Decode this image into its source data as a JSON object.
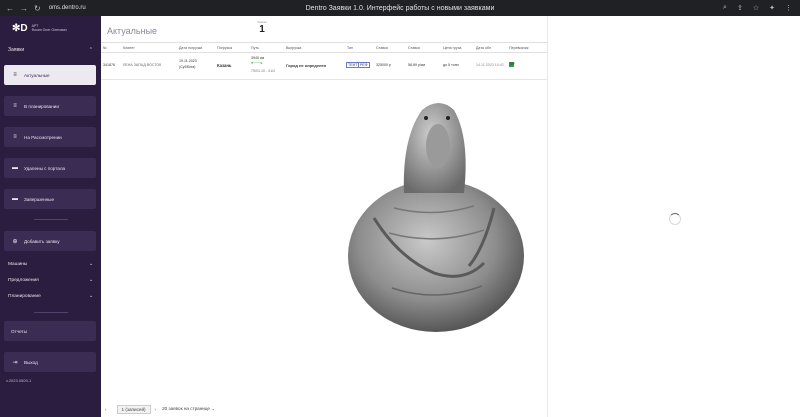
{
  "browser": {
    "url": "oms.dentro.ru",
    "window_title": "Dentro Заявки 1.0. Интерфейс работы с новыми заявками"
  },
  "sidebar": {
    "logo": "D",
    "user_role": "АРТ",
    "user_name": "Фокин Олег Олегович",
    "section_label": "Заявки",
    "items": [
      {
        "label": "Актуальные",
        "icon": "list-icon",
        "active": true
      },
      {
        "label": "В планировании",
        "icon": "list-icon"
      },
      {
        "label": "На Рассмотрении",
        "icon": "list-icon"
      },
      {
        "label": "Удалены с портала",
        "icon": "folder-icon"
      },
      {
        "label": "Завершенные",
        "icon": "folder-icon"
      }
    ],
    "add_label": "Добавить заявку",
    "folds": [
      "Машины",
      "Предложения",
      "Планирование"
    ],
    "reports_label": "Отчеты",
    "logout_label": "Выход",
    "version": "v.2023.0509-1"
  },
  "main": {
    "title": "Актуальные",
    "counter_label": "Заявки",
    "counter_value": "1",
    "columns": [
      "№",
      "Клиент",
      "Дата погрузки",
      "Погрузка",
      "Путь",
      "Выгрузка",
      "Тип",
      "Ставка",
      "Ставка",
      "Цена груза",
      "Дата обн",
      "Перевозчик"
    ],
    "row": {
      "id": "341876",
      "client": "ЛЕНА ЗАПАД ВОСТОК",
      "date": "19.11.2023",
      "time": "(Суббота)",
      "load_city": "Казань",
      "route_km": "3940 км",
      "route_note": "75/01.10 - 41/2",
      "unload_city": "Город не определен",
      "tags": [
        "ТЕНТ",
        "РЕФ"
      ],
      "rate": "325000 р",
      "rate_km": "58.89 р/км",
      "cargo": "до 5 тонн",
      "updated": "14.11.2023 10:42",
      "carrier": "TIP"
    },
    "pagination": {
      "page": "1 (записей)",
      "per_page": "20 заявок на странице"
    }
  }
}
